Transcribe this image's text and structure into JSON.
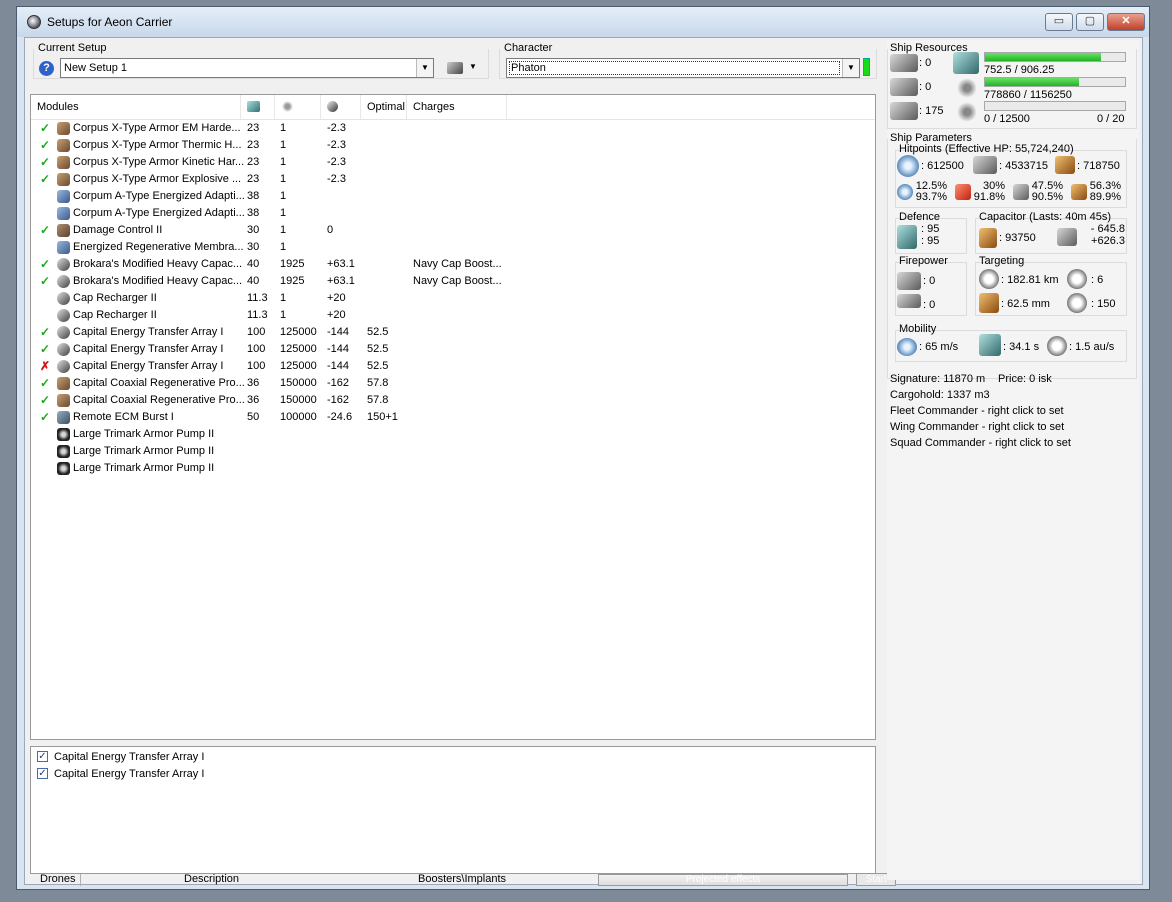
{
  "window": {
    "title": "Setups for Aeon Carrier",
    "btn_min": "▭",
    "btn_max": "▢",
    "btn_close": "✕"
  },
  "setup": {
    "label": "Current Setup",
    "value": "New Setup 1",
    "help": "?"
  },
  "character": {
    "label": "Character",
    "value": "Phaton"
  },
  "modules": {
    "headers": {
      "name": "Modules",
      "optimal": "Optimal",
      "charges": "Charges"
    },
    "rows": [
      {
        "state": "ok",
        "icon": "armor",
        "name": "Corpus X-Type Armor EM Harde...",
        "cpu": "23",
        "pg": "1",
        "cap": "-2.3",
        "opt": "",
        "ch": ""
      },
      {
        "state": "ok",
        "icon": "armor",
        "name": "Corpus X-Type Armor Thermic H...",
        "cpu": "23",
        "pg": "1",
        "cap": "-2.3",
        "opt": "",
        "ch": ""
      },
      {
        "state": "ok",
        "icon": "armor",
        "name": "Corpus X-Type Armor Kinetic Har...",
        "cpu": "23",
        "pg": "1",
        "cap": "-2.3",
        "opt": "",
        "ch": ""
      },
      {
        "state": "ok",
        "icon": "armor",
        "name": "Corpus X-Type Armor Explosive ...",
        "cpu": "23",
        "pg": "1",
        "cap": "-2.3",
        "opt": "",
        "ch": ""
      },
      {
        "state": "",
        "icon": "adapt",
        "name": "Corpum A-Type Energized Adapti...",
        "cpu": "38",
        "pg": "1",
        "cap": "",
        "opt": "",
        "ch": ""
      },
      {
        "state": "",
        "icon": "adapt",
        "name": "Corpum A-Type Energized Adapti...",
        "cpu": "38",
        "pg": "1",
        "cap": "",
        "opt": "",
        "ch": ""
      },
      {
        "state": "ok",
        "icon": "dc",
        "name": "Damage Control II",
        "cpu": "30",
        "pg": "1",
        "cap": "0",
        "opt": "",
        "ch": ""
      },
      {
        "state": "",
        "icon": "adapt",
        "name": "Energized Regenerative Membra...",
        "cpu": "30",
        "pg": "1",
        "cap": "",
        "opt": "",
        "ch": ""
      },
      {
        "state": "ok",
        "icon": "cap",
        "name": "Brokara's Modified Heavy Capac...",
        "cpu": "40",
        "pg": "1925",
        "cap": "+63.1",
        "opt": "",
        "ch": "Navy Cap Boost..."
      },
      {
        "state": "ok",
        "icon": "cap",
        "name": "Brokara's Modified Heavy Capac...",
        "cpu": "40",
        "pg": "1925",
        "cap": "+63.1",
        "opt": "",
        "ch": "Navy Cap Boost..."
      },
      {
        "state": "",
        "icon": "cap",
        "name": "Cap Recharger II",
        "cpu": "11.3",
        "pg": "1",
        "cap": "+20",
        "opt": "",
        "ch": ""
      },
      {
        "state": "",
        "icon": "cap",
        "name": "Cap Recharger II",
        "cpu": "11.3",
        "pg": "1",
        "cap": "+20",
        "opt": "",
        "ch": ""
      },
      {
        "state": "ok",
        "icon": "cap",
        "name": "Capital Energy Transfer Array I",
        "cpu": "100",
        "pg": "125000",
        "cap": "-144",
        "opt": "52.5",
        "ch": ""
      },
      {
        "state": "ok",
        "icon": "cap",
        "name": "Capital Energy Transfer Array I",
        "cpu": "100",
        "pg": "125000",
        "cap": "-144",
        "opt": "52.5",
        "ch": ""
      },
      {
        "state": "bad",
        "icon": "cap",
        "name": "Capital Energy Transfer Array I",
        "cpu": "100",
        "pg": "125000",
        "cap": "-144",
        "opt": "52.5",
        "ch": ""
      },
      {
        "state": "ok",
        "icon": "armor",
        "name": "Capital Coaxial Regenerative Pro...",
        "cpu": "36",
        "pg": "150000",
        "cap": "-162",
        "opt": "57.8",
        "ch": ""
      },
      {
        "state": "ok",
        "icon": "armor",
        "name": "Capital Coaxial Regenerative Pro...",
        "cpu": "36",
        "pg": "150000",
        "cap": "-162",
        "opt": "57.8",
        "ch": ""
      },
      {
        "state": "ok",
        "icon": "ecm",
        "name": "Remote ECM Burst I",
        "cpu": "50",
        "pg": "100000",
        "cap": "-24.6",
        "opt": "150+1",
        "ch": ""
      },
      {
        "state": "",
        "icon": "rig",
        "name": "Large Trimark Armor Pump II",
        "cpu": "",
        "pg": "",
        "cap": "",
        "opt": "",
        "ch": ""
      },
      {
        "state": "",
        "icon": "rig",
        "name": "Large Trimark Armor Pump II",
        "cpu": "",
        "pg": "",
        "cap": "",
        "opt": "",
        "ch": ""
      },
      {
        "state": "",
        "icon": "rig",
        "name": "Large Trimark Armor Pump II",
        "cpu": "",
        "pg": "",
        "cap": "",
        "opt": "",
        "ch": ""
      }
    ]
  },
  "projected": [
    {
      "checked": "✓",
      "label": "Capital Energy Transfer Array I"
    },
    {
      "checked": "✓",
      "label": "Capital Energy Transfer Array I"
    }
  ],
  "statusbar": {
    "drones": "Drones",
    "description": "Description",
    "boosters": "Boosters\\Implants",
    "progress": "Projected effects",
    "start": "Start"
  },
  "resources": {
    "title": "Ship Resources",
    "turrets": ": 0",
    "launchers": ": 0",
    "calibration": ": 175",
    "cpu_text": "752.5 / 906.25",
    "cpu_frac": 0.83,
    "pg_text": "778860 / 1156250",
    "pg_frac": 0.67,
    "drone_text": "0 / 12500",
    "drone_frac": 0,
    "drone_bw": "0 / 20"
  },
  "params": {
    "title": "Ship Parameters",
    "hp_title": "Hitpoints (Effective HP: 55,724,240)",
    "shield_hp": ": 612500",
    "armor_hp": ": 4533715",
    "structure_hp": ": 718750",
    "res": [
      {
        "a": "12.5%",
        "b": "93.7%"
      },
      {
        "a": "30%",
        "b": "91.8%"
      },
      {
        "a": "47.5%",
        "b": "90.5%"
      },
      {
        "a": "56.3%",
        "b": "89.9%"
      }
    ],
    "defence_title": "Defence",
    "def_a": ": 95",
    "def_b": ": 95",
    "cap_title": "Capacitor (Lasts: 40m 45s)",
    "cap_amount": ": 93750",
    "cap_use": "- 645.8",
    "cap_gain": "+626.3",
    "fire_title": "Firepower",
    "fire_a": ": 0",
    "fire_b": ": 0",
    "target_title": "Targeting",
    "range": ": 182.81 km",
    "max_targets": ": 6",
    "sig_res": ": 62.5 mm",
    "scan_res": ": 150",
    "mob_title": "Mobility",
    "speed": ": 65 m/s",
    "align": ": 34.1 s",
    "warp": ": 1.5 au/s",
    "signature": "Signature: 11870 m",
    "price": "Price: 0 isk",
    "cargo": "Cargohold: 1337 m3",
    "fleet": "Fleet Commander - right click to set",
    "wing": "Wing Commander - right click to set",
    "squad": "Squad Commander - right click to set"
  }
}
